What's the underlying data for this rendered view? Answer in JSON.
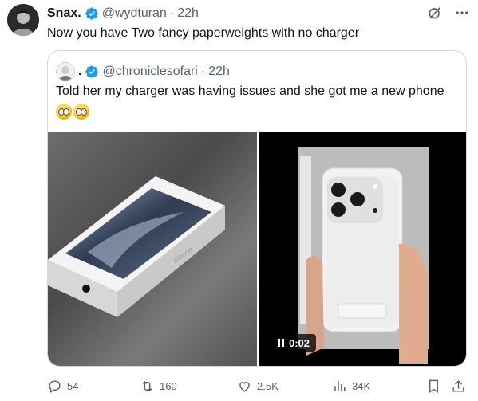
{
  "tweet": {
    "author_name": "Snax.",
    "author_handle": "@wydturan",
    "separator": "·",
    "time": "22h",
    "text": "Now you have Two fancy paperweights with no charger"
  },
  "quote": {
    "author_name": ".",
    "author_handle": "@chroniclesofari",
    "separator": "·",
    "time": "22h",
    "text": "Told her my charger was having issues and she got me a new phone",
    "emojis": [
      "pleading-face",
      "pleading-face"
    ],
    "media": {
      "left_image": "iphone-box-photo",
      "box_label": "iPhone",
      "right_video": "white-phone-video",
      "video_time": "0:02"
    }
  },
  "actions": {
    "replies": "54",
    "reposts": "160",
    "likes": "2.5K",
    "views": "34K"
  },
  "icons": {
    "verified": "verified-badge-icon",
    "grok": "grok-icon",
    "more": "more-icon",
    "reply": "reply-icon",
    "repost": "repost-icon",
    "like": "like-icon",
    "views": "views-icon",
    "bookmark": "bookmark-icon",
    "share": "share-icon"
  },
  "colors": {
    "accent": "#1d9bf0",
    "secondary_text": "#536471",
    "border": "#cfd9de"
  }
}
